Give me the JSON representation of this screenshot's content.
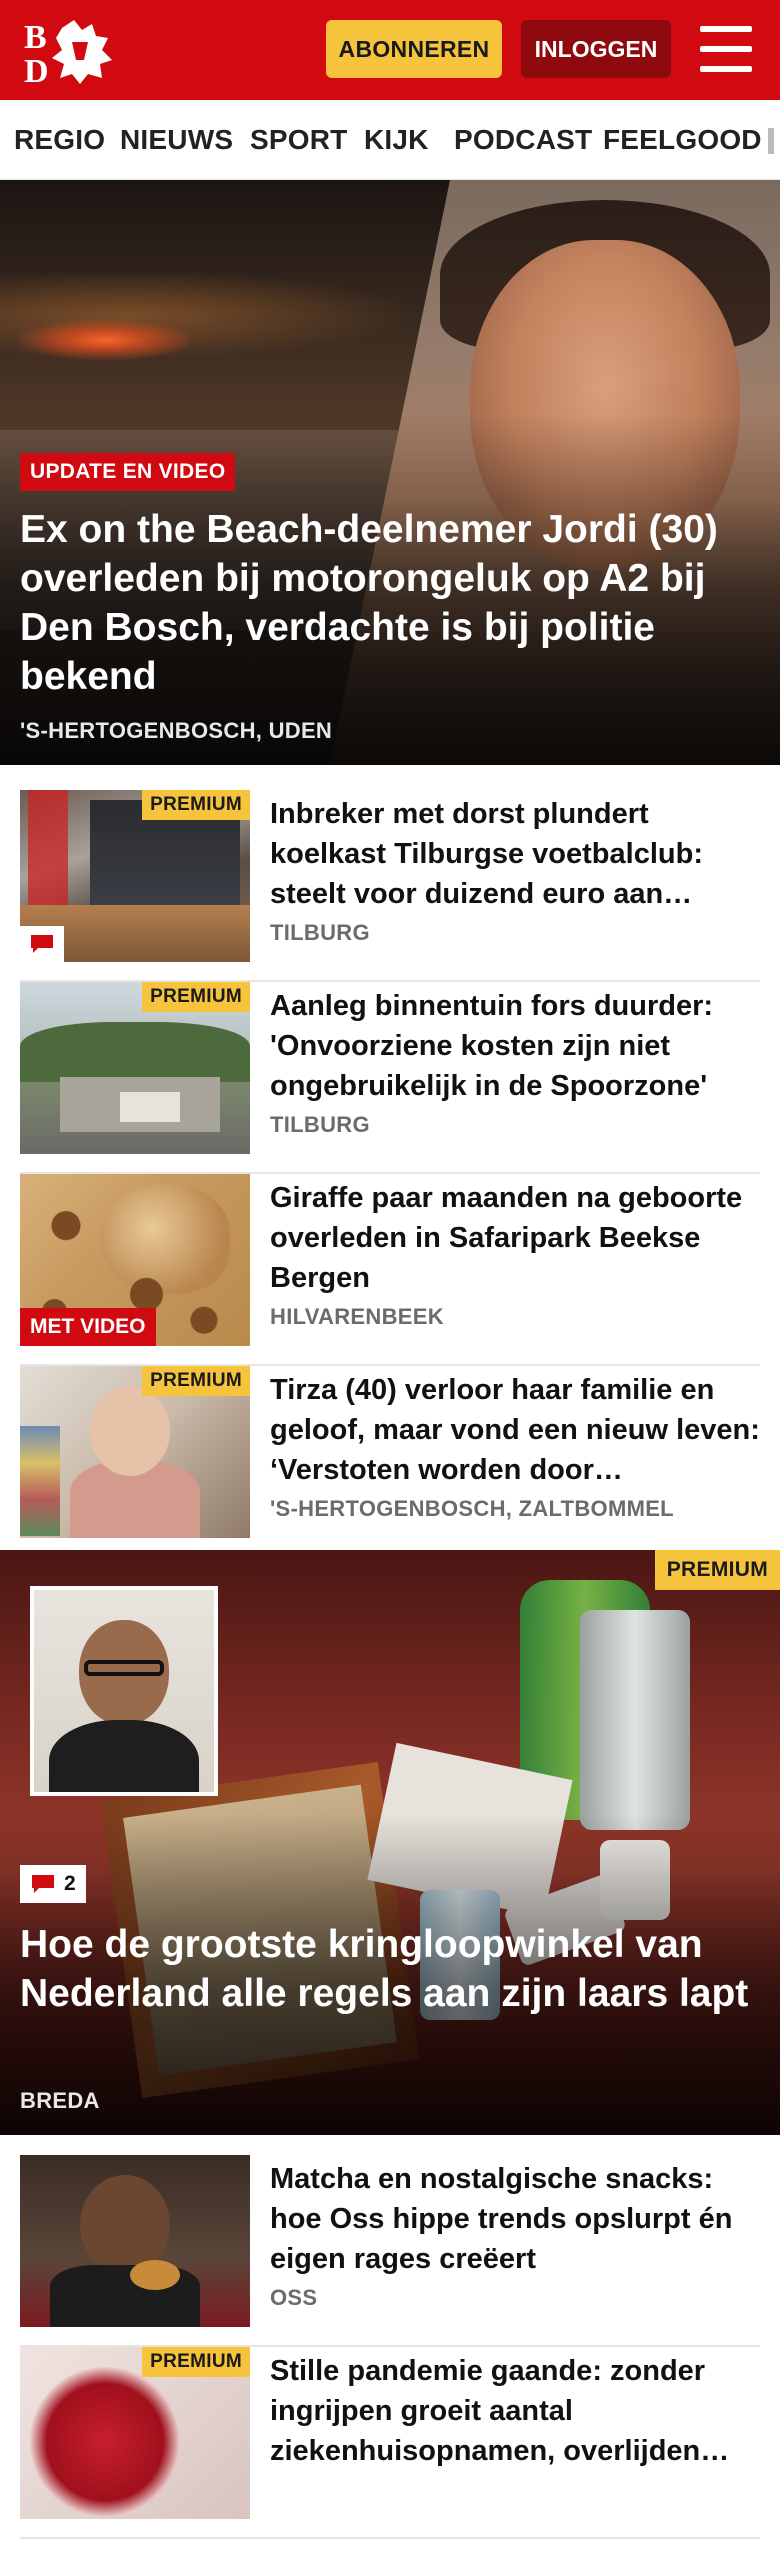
{
  "header": {
    "logo_text": "BD",
    "subscribe_label": "ABONNEREN",
    "login_label": "INLOGGEN",
    "brand_color": "#d10a11"
  },
  "nav": {
    "tabs": [
      "REGIO",
      "NIEUWS",
      "SPORT",
      "KIJK",
      "PODCAST",
      "FEELGOOD"
    ]
  },
  "hero": {
    "tag": "UPDATE EN VIDEO",
    "title": "Ex on the Beach-deelnemer Jordi (30) overleden bij motorongeluk op A2 bij Den Bosch, verdachte is bij politie bekend",
    "location": "'S-HERTOGENBOSCH, UDEN"
  },
  "articles_top": [
    {
      "badge": "PREMIUM",
      "title": "Inbreker met dorst plundert koelkast Tilburgse voetbalclub: steelt voor duizend euro aan…",
      "location": "TILBURG",
      "has_comments": true
    },
    {
      "badge": "PREMIUM",
      "title": "Aanleg binnentuin fors duurder: 'Onvoorziene kosten zijn niet ongebruikelijk in de Spoorzone'",
      "location": "TILBURG"
    },
    {
      "video_tag": "MET VIDEO",
      "title": "Giraffe paar maanden na geboorte overleden in Safaripark Beekse Bergen",
      "location": "HILVARENBEEK"
    },
    {
      "badge": "PREMIUM",
      "title": "Tirza (40) verloor haar familie en geloof, maar vond een nieuw leven: ‘Verstoten worden door…",
      "location": "'S-HERTOGENBOSCH, ZALTBOMMEL"
    }
  ],
  "feature": {
    "badge": "PREMIUM",
    "comment_count": "2",
    "title": "Hoe de grootste kringloopwinkel van Nederland alle regels aan zijn laars lapt",
    "location": "BREDA"
  },
  "articles_bottom": [
    {
      "title": "Matcha en nostalgische snacks: hoe Oss hippe trends opslurpt én eigen rages creëert",
      "location": "OSS"
    },
    {
      "badge": "PREMIUM",
      "title": "Stille pandemie gaande: zonder ingrijpen groeit aantal ziekenhuisopnamen, overlijden…"
    }
  ]
}
